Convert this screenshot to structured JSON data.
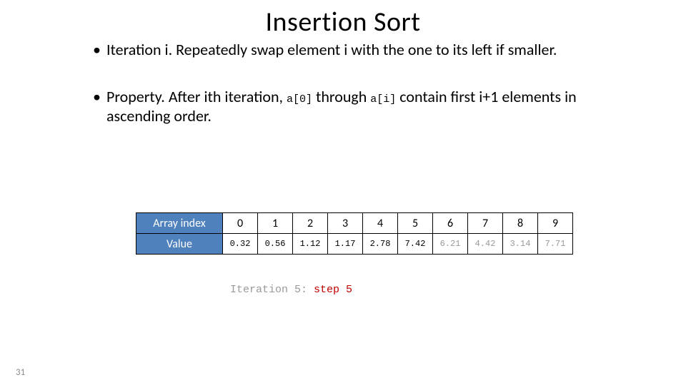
{
  "title": "Insertion Sort",
  "bullets": {
    "b1_pre": "Iteration i.  Repeatedly swap element i with the one to its left if smaller.",
    "b2_pre": "Property.  After ith iteration, ",
    "b2_code1": "a[0]",
    "b2_mid": " through ",
    "b2_code2": "a[i]",
    "b2_post": " contain first i+1 elements in ascending order."
  },
  "table": {
    "row1_label": "Array index",
    "row2_label": "Value",
    "indices": [
      "0",
      "1",
      "2",
      "3",
      "4",
      "5",
      "6",
      "7",
      "8",
      "9"
    ],
    "values": [
      "0.32",
      "0.56",
      "1.12",
      "1.17",
      "2.78",
      "7.42",
      "6.21",
      "4.42",
      "3.14",
      "7.71"
    ],
    "sorted_count": 6
  },
  "iteration": {
    "pre": "Iteration 5: ",
    "step": "step 5"
  },
  "page_number": "31",
  "chart_data": {
    "type": "table",
    "title": "Insertion Sort state after Iteration 5 step 5",
    "columns": [
      "0",
      "1",
      "2",
      "3",
      "4",
      "5",
      "6",
      "7",
      "8",
      "9"
    ],
    "rows": [
      {
        "name": "Value",
        "values": [
          0.32,
          0.56,
          1.12,
          1.17,
          2.78,
          7.42,
          6.21,
          4.42,
          3.14,
          7.71
        ]
      }
    ],
    "sorted_prefix_length": 6
  }
}
